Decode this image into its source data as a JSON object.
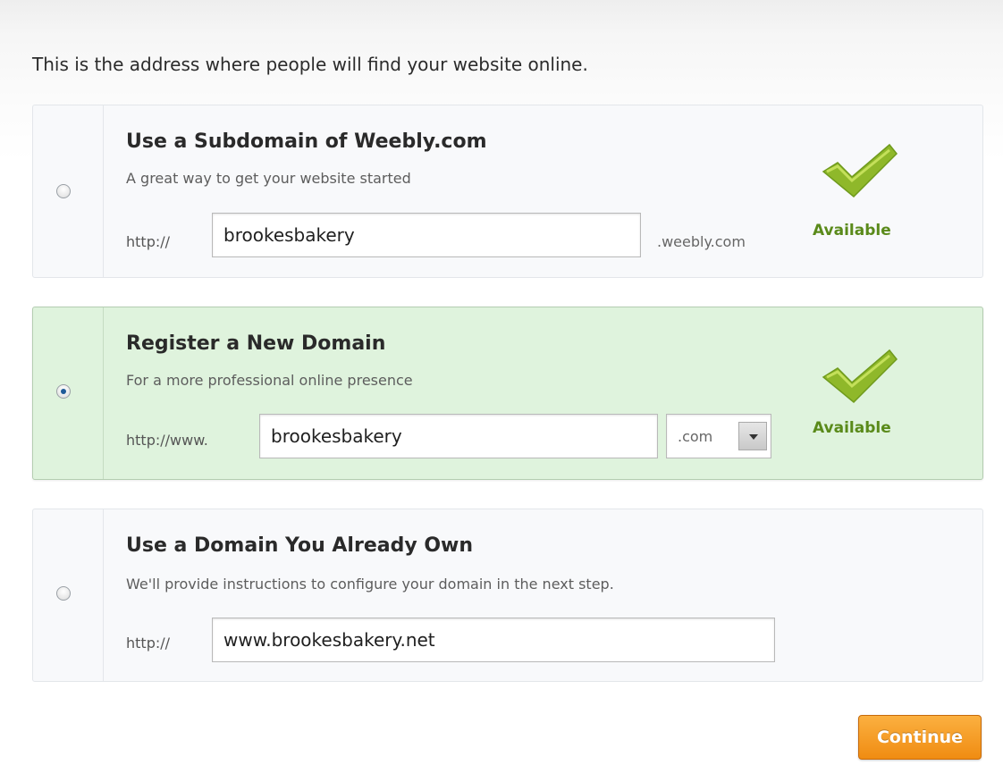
{
  "intro_text": "This is the address where people will find your website online.",
  "options": [
    {
      "title": "Use a Subdomain of Weebly.com",
      "subtitle": "A great way to get your website started",
      "prefix": "http://",
      "value": "brookesbakery",
      "suffix": ".weebly.com",
      "status": "Available",
      "selected": false
    },
    {
      "title": "Register a New Domain",
      "subtitle": "For a more professional online presence",
      "prefix": "http://www.",
      "value": "brookesbakery",
      "tld": ".com",
      "status": "Available",
      "selected": true
    },
    {
      "title": "Use a Domain You Already Own",
      "subtitle": "We'll provide instructions to configure your domain in the next step.",
      "prefix": "http://",
      "value": "www.brookesbakery.net",
      "selected": false
    }
  ],
  "continue_label": "Continue",
  "colors": {
    "selected_bg": "#dff3dd",
    "available_green": "#5a8a1a",
    "button_orange": "#f08c12"
  },
  "icons": {
    "available": "check-mark-icon",
    "dropdown": "chevron-down-icon"
  }
}
